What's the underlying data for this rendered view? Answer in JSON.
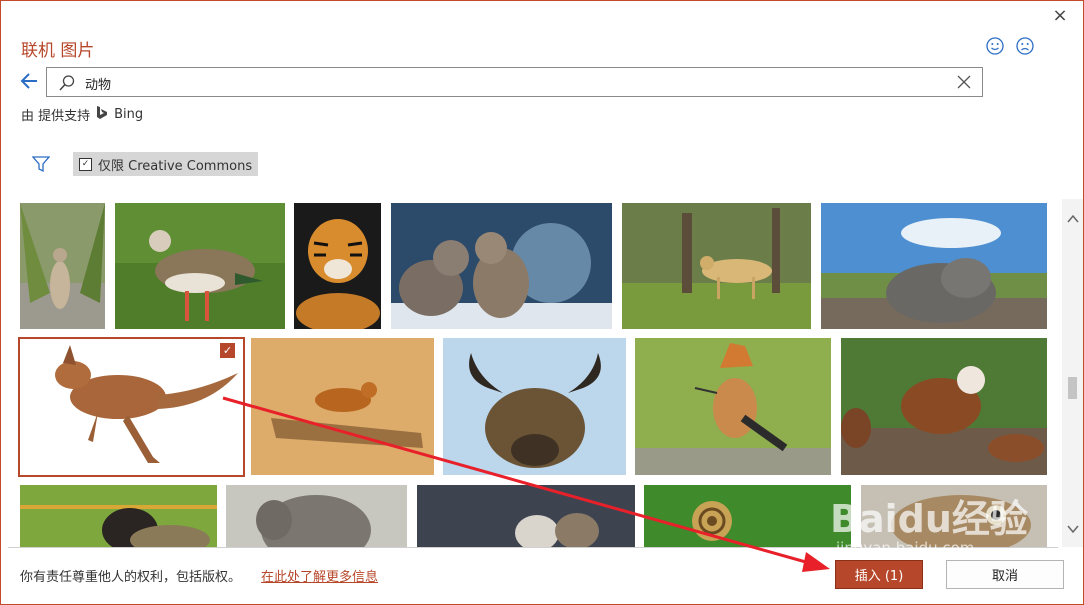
{
  "dialog": {
    "title": "联机 图片",
    "close_glyph": "×",
    "back_icon": "arrow-left-icon"
  },
  "search": {
    "value": "动物",
    "placeholder": "",
    "clear_icon": "close-icon"
  },
  "provider": {
    "text": "由 提供支持",
    "brand": "Bing"
  },
  "filter": {
    "creative_commons_label": "仅限 Creative Commons",
    "checked": true
  },
  "images": [
    {
      "label": "meerkat",
      "selected": false
    },
    {
      "label": "egyptian-goose",
      "selected": false
    },
    {
      "label": "tiger",
      "selected": false
    },
    {
      "label": "sea-lion-pups",
      "selected": false
    },
    {
      "label": "cheetah",
      "selected": false
    },
    {
      "label": "hippo-in-mud",
      "selected": false
    },
    {
      "label": "kangaroo",
      "selected": true
    },
    {
      "label": "fox-on-log",
      "selected": false
    },
    {
      "label": "long-horned-cow",
      "selected": false
    },
    {
      "label": "hoopoe-bird",
      "selected": false
    },
    {
      "label": "brown-cows",
      "selected": false
    },
    {
      "label": "black-face-sheep",
      "selected": false
    },
    {
      "label": "elephant",
      "selected": false
    },
    {
      "label": "kittens",
      "selected": false
    },
    {
      "label": "snail",
      "selected": false
    },
    {
      "label": "eagle",
      "selected": false
    }
  ],
  "footer": {
    "notice": "你有责任尊重他人的权利，包括版权。",
    "learn_more": "在此处了解更多信息",
    "insert_label": "插入 (1)",
    "cancel_label": "取消"
  },
  "watermark": {
    "brand": "Baidu经验",
    "url": "jingyan.baidu.com"
  },
  "colors": {
    "accent": "#b7472a",
    "annotation_arrow": "#e8202a"
  }
}
